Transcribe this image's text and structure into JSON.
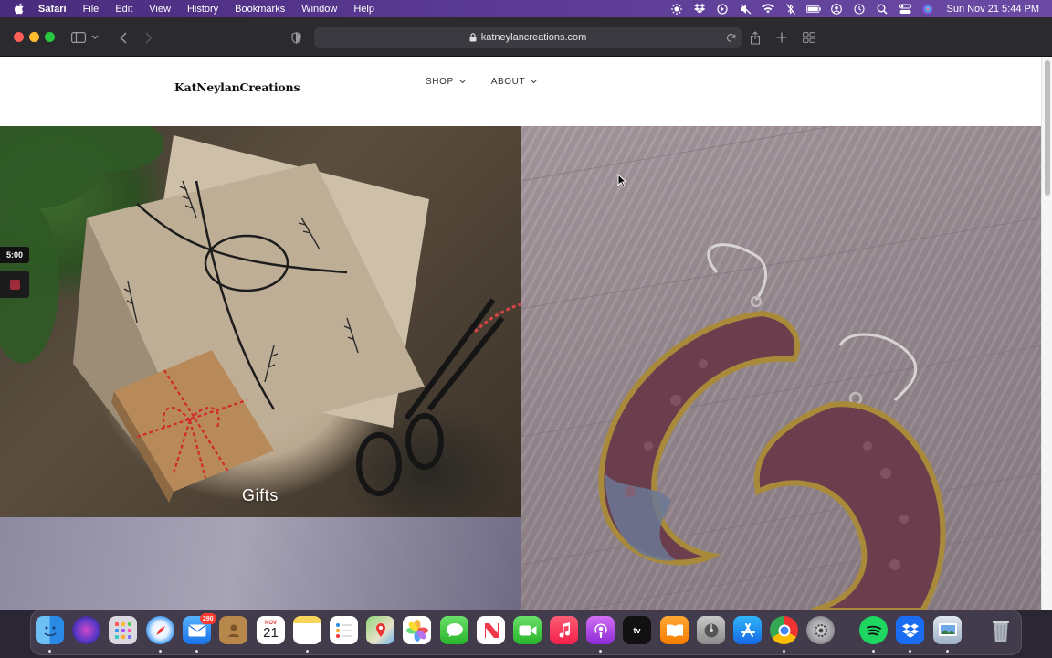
{
  "menubar": {
    "app_name": "Safari",
    "items": [
      "File",
      "Edit",
      "View",
      "History",
      "Bookmarks",
      "Window",
      "Help"
    ],
    "clock": "Sun Nov 21  5:44 PM",
    "status_icons": [
      "brightness-icon",
      "dropbox-icon",
      "play-icon",
      "mute-icon",
      "wifi-icon",
      "bluetooth-off-icon",
      "battery-icon",
      "user-icon",
      "time-machine-icon",
      "search-icon",
      "control-center-icon",
      "siri-icon"
    ]
  },
  "browser": {
    "url": "katneylancreations.com"
  },
  "site": {
    "logo": "KatNeylanCreations",
    "nav": [
      {
        "label": "SHOP"
      },
      {
        "label": "ABOUT"
      }
    ],
    "tiles": [
      {
        "label": "Gifts"
      }
    ]
  },
  "overlay": {
    "timer": "5:00"
  },
  "dock": {
    "apps": [
      "Finder",
      "Siri",
      "Launchpad",
      "Safari",
      "Mail",
      "Contacts",
      "Calendar",
      "Notes",
      "Reminders",
      "Maps",
      "Photos",
      "Messages",
      "News",
      "FaceTime",
      "Music",
      "Podcasts",
      "TV",
      "Books",
      "Disk Utility",
      "App Store",
      "Chrome",
      "System Preferences",
      "Spotify",
      "Dropbox",
      "Preview",
      "Trash"
    ],
    "mail_badge": "290",
    "calendar_month": "NOV",
    "calendar_day": "21"
  },
  "colors": {
    "menubar": "#4a2c7e",
    "toolbar": "#2b2a2f",
    "page_bg": "#ffffff"
  }
}
